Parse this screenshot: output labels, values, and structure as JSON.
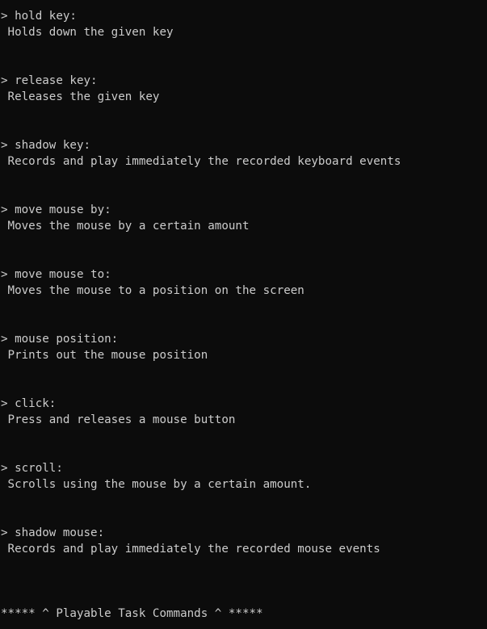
{
  "commands": [
    {
      "title": "> hold key:",
      "description": " Holds down the given key"
    },
    {
      "title": "> release key:",
      "description": " Releases the given key"
    },
    {
      "title": "> shadow key:",
      "description": " Records and play immediately the recorded keyboard events"
    },
    {
      "title": "> move mouse by:",
      "description": " Moves the mouse by a certain amount"
    },
    {
      "title": "> move mouse to:",
      "description": " Moves the mouse to a position on the screen"
    },
    {
      "title": "> mouse position:",
      "description": " Prints out the mouse position"
    },
    {
      "title": "> click:",
      "description": " Press and releases a mouse button"
    },
    {
      "title": "> scroll:",
      "description": " Scrolls using the mouse by a certain amount."
    },
    {
      "title": "> shadow mouse:",
      "description": " Records and play immediately the recorded mouse events"
    }
  ],
  "footer": "***** ^ Playable Task Commands ^ *****"
}
